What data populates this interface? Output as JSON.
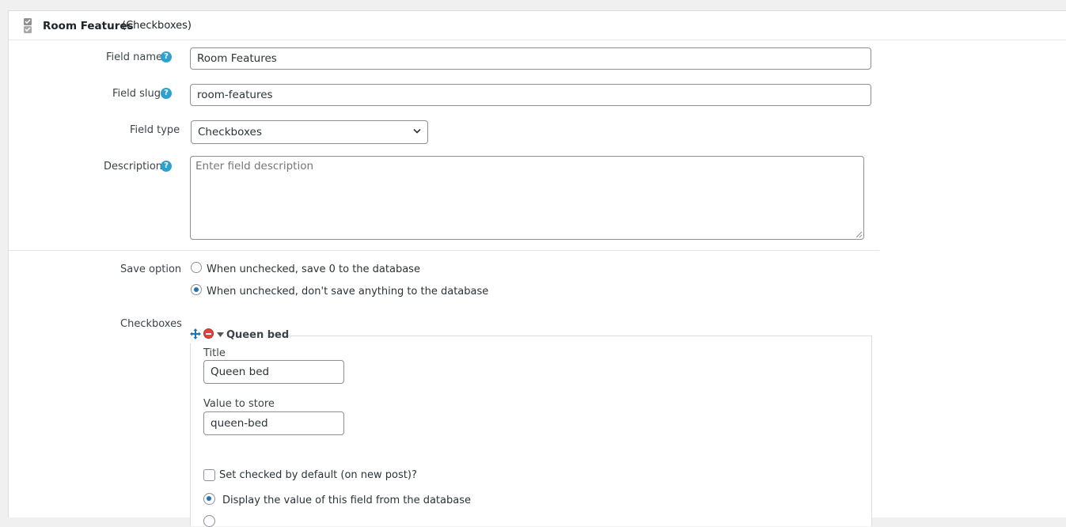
{
  "header": {
    "title": "Room Features",
    "type": "(Checkboxes)",
    "icon": "checkbox-field-icon"
  },
  "fields": {
    "name": {
      "label": "Field name",
      "value": "Room Features"
    },
    "slug": {
      "label": "Field slug",
      "value": "room-features"
    },
    "type": {
      "label": "Field type",
      "value": "Checkboxes"
    },
    "description": {
      "label": "Description",
      "placeholder": "Enter field description"
    },
    "help_glyph": "?"
  },
  "save_option": {
    "label": "Save option",
    "options": [
      {
        "label": "When unchecked, save 0 to the database",
        "checked": false
      },
      {
        "label": "When unchecked, don't save anything to the database",
        "checked": true
      }
    ]
  },
  "checkboxes": {
    "label": "Checkboxes",
    "item": {
      "title": "Queen bed",
      "title_label": "Title",
      "title_value": "Queen bed",
      "value_label": "Value to store",
      "value_value": "queen-bed",
      "default_label": "Set checked by default (on new post)?",
      "display_option": "Display the value of this field from the database"
    }
  },
  "colors": {
    "help": "#2ea2cc",
    "accent": "#2271b1",
    "remove": "#e0433f"
  }
}
